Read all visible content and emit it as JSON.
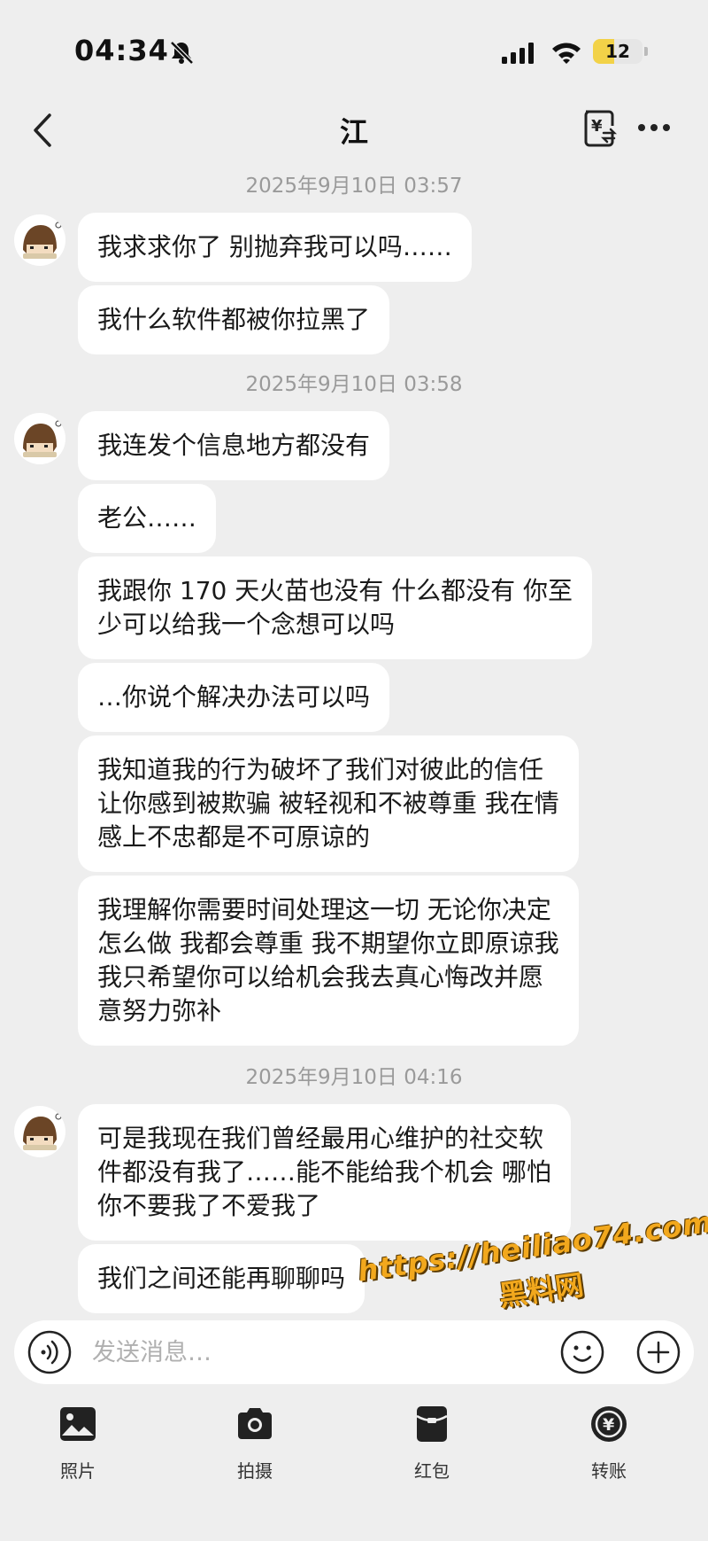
{
  "status_bar": {
    "time": "04:34",
    "battery_level": "12",
    "battery_fraction": 0.12,
    "battery_color": "#f2d248"
  },
  "header": {
    "title": "江",
    "back_icon": "chevron-left-icon",
    "transfer_icon": "yuan-transfer-icon",
    "more_icon": "more-dots-icon"
  },
  "messages": {
    "groups": [
      {
        "timestamp": "2025年9月10日 03:57",
        "bubbles": [
          "我求求你了 别抛弃我可以吗……",
          "我什么软件都被你拉黑了"
        ]
      },
      {
        "timestamp": "2025年9月10日 03:58",
        "bubbles": [
          "我连发个信息地方都没有",
          "老公……",
          "我跟你 170 天火苗也没有 什么都没有 你至\n少可以给我一个念想可以吗",
          "…你说个解决办法可以吗",
          "我知道我的行为破坏了我们对彼此的信任\n让你感到被欺骗 被轻视和不被尊重 我在情\n感上不忠都是不可原谅的",
          "我理解你需要时间处理这一切 无论你决定\n怎么做 我都会尊重 我不期望你立即原谅我\n我只希望你可以给机会我去真心悔改并愿\n意努力弥补"
        ]
      },
      {
        "timestamp": "2025年9月10日 04:16",
        "bubbles": [
          "可是我现在我们曾经最用心维护的社交软\n件都没有我了……能不能给我个机会 哪怕\n你不要我了不爱我了",
          "我们之间还能再聊聊吗"
        ]
      }
    ]
  },
  "input": {
    "placeholder": "发送消息…",
    "value": ""
  },
  "watermark": {
    "line1": "https://heiliao74.com",
    "line2": "黑料网"
  },
  "tools": [
    {
      "label": "照片",
      "icon": "photo-icon"
    },
    {
      "label": "拍摄",
      "icon": "camera-icon"
    },
    {
      "label": "红包",
      "icon": "red-packet-icon"
    },
    {
      "label": "转账",
      "icon": "transfer-coin-icon"
    }
  ]
}
